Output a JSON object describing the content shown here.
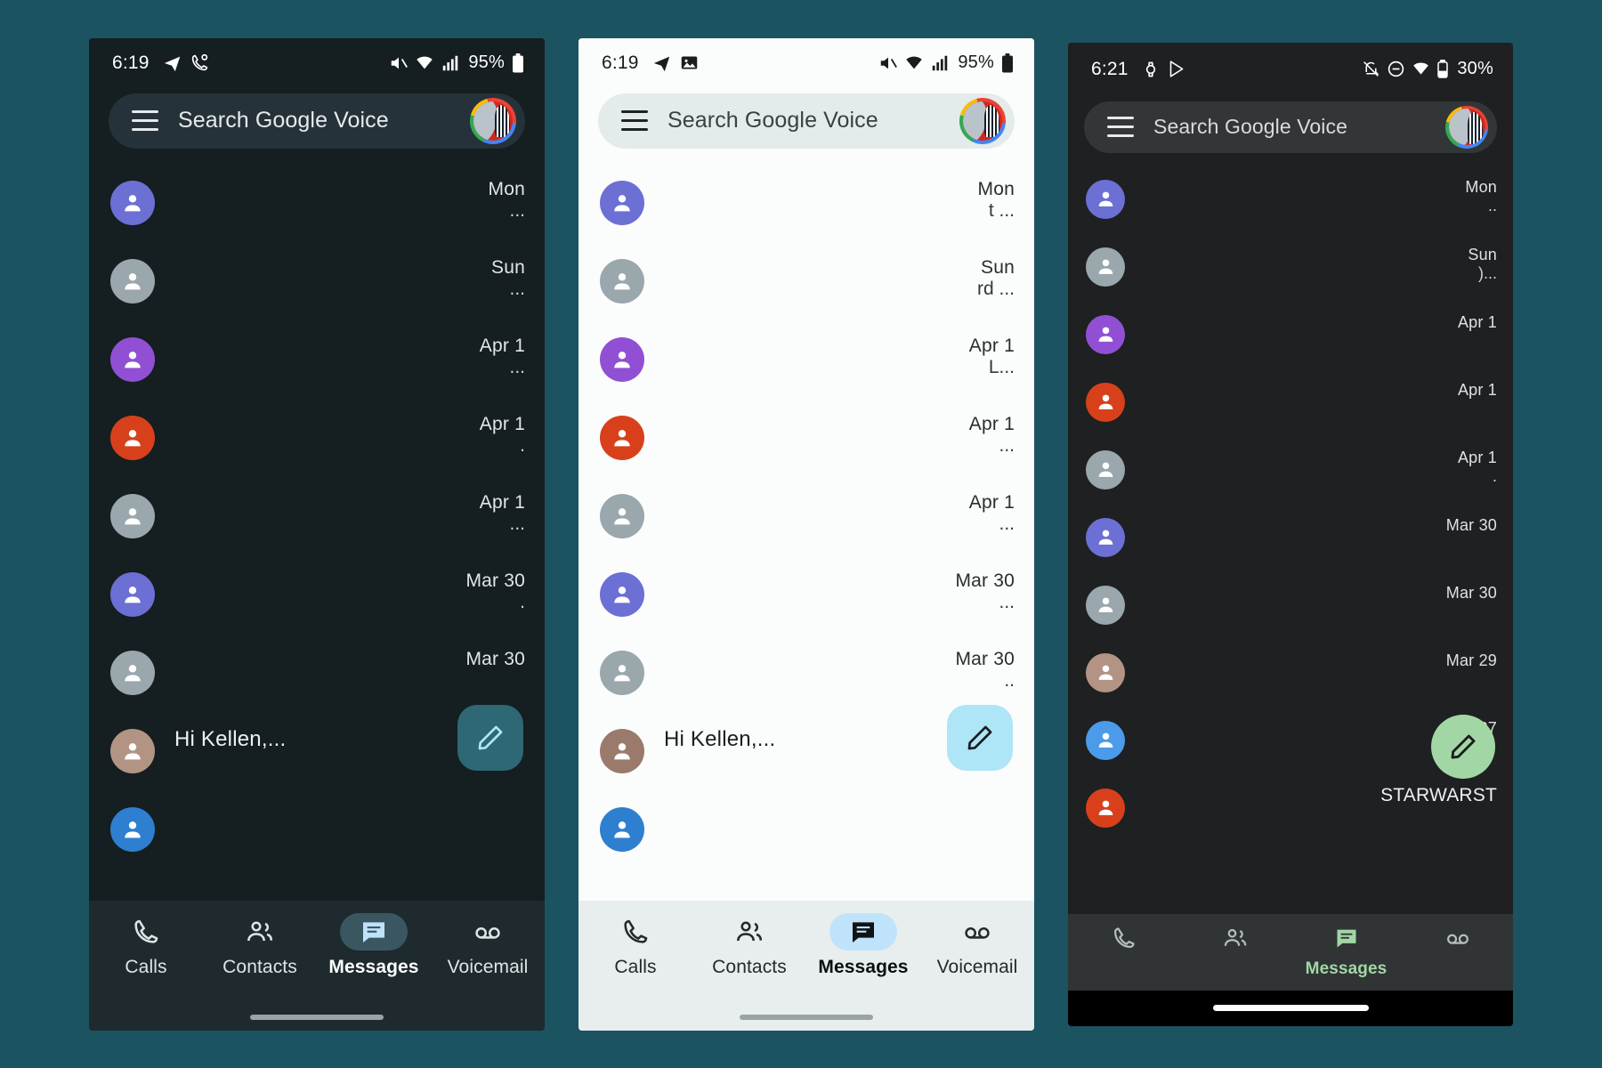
{
  "app": {
    "name": "Google Voice",
    "screen": "Messages"
  },
  "background_color": "#1b5361",
  "panels": [
    {
      "id": "panel-dark",
      "theme": "dark",
      "colors": {
        "background": "#151e20",
        "searchbar": "#263239",
        "nav": "#1e2a2e",
        "fab": "#2d6874",
        "fab_icon": "#aee5f7",
        "accent_pill": "#3a5761"
      },
      "status_bar": {
        "time": "6:19",
        "left_icons": [
          "telegram-icon",
          "call-forward-icon"
        ],
        "right_icons": [
          "volume-off-icon",
          "wifi-icon",
          "cellular-signal-icon"
        ],
        "battery_percent": "95%"
      },
      "search": {
        "placeholder": "Search Google Voice",
        "menu_icon": "hamburger-menu-icon",
        "avatar_icon": "google-account-avatar"
      },
      "conversations": [
        {
          "avatar_color": "#6c6fd4",
          "time": "Mon",
          "tail": "...",
          "redacted": true,
          "title_w": 300,
          "sub_w": 375
        },
        {
          "avatar_color": "#9aa7ad",
          "time": "Sun",
          "tail": "...",
          "redacted": true,
          "title_w": 180,
          "sub_w": 365
        },
        {
          "avatar_color": "#9150d4",
          "time": "Apr 1",
          "tail": "...",
          "redacted": true,
          "title_w": 250,
          "sub_w": 370
        },
        {
          "avatar_color": "#d8401c",
          "time": "Apr 1",
          "tail": ".",
          "redacted": true,
          "title_w": 230,
          "sub_w": 355
        },
        {
          "avatar_color": "#9aa7ad",
          "time": "Apr 1",
          "tail": "...",
          "redacted": true,
          "title_w": 210,
          "sub_w": 360
        },
        {
          "avatar_color": "#6c6fd4",
          "time": "Mar 30",
          "tail": ".",
          "redacted": true,
          "title_w": 195,
          "sub_w": 340
        },
        {
          "avatar_color": "#9aa7ad",
          "time": "Mar 30",
          "tail": "",
          "redacted": true,
          "title_w": 205,
          "sub_w": 350
        },
        {
          "avatar_color": "#b39484",
          "time": "",
          "tail": "",
          "redacted": true,
          "title_w": 175,
          "preview_text": "Hi Kellen,..."
        }
      ],
      "fab": {
        "icon": "compose-pencil-icon",
        "shape": "rounded-square"
      },
      "nav": {
        "items": [
          {
            "label": "Calls",
            "icon": "phone-icon",
            "active": false
          },
          {
            "label": "Contacts",
            "icon": "people-icon",
            "active": false
          },
          {
            "label": "Messages",
            "icon": "message-icon",
            "active": true
          },
          {
            "label": "Voicemail",
            "icon": "voicemail-icon",
            "active": false
          }
        ]
      }
    },
    {
      "id": "panel-light",
      "theme": "light",
      "colors": {
        "background": "#fbfcfc",
        "searchbar": "#e3eceb",
        "nav": "#e7eeed",
        "fab": "#aee5f7",
        "fab_icon": "#1a1c1e",
        "accent_pill": "#bfe3fb"
      },
      "status_bar": {
        "time": "6:19",
        "left_icons": [
          "telegram-icon",
          "image-icon"
        ],
        "right_icons": [
          "volume-off-icon",
          "wifi-icon",
          "cellular-signal-icon"
        ],
        "battery_percent": "95%"
      },
      "search": {
        "placeholder": "Search Google Voice",
        "menu_icon": "hamburger-menu-icon",
        "avatar_icon": "google-account-avatar"
      },
      "conversations": [
        {
          "avatar_color": "#6c6fd4",
          "time": "Mon",
          "tail": "t ...",
          "redacted": true,
          "title_w": 300,
          "sub_w": 350
        },
        {
          "avatar_color": "#9aa7ad",
          "time": "Sun",
          "tail": "rd ...",
          "redacted": true,
          "title_w": 180,
          "sub_w": 335
        },
        {
          "avatar_color": "#9150d4",
          "time": "Apr 1",
          "tail": "L...",
          "redacted": true,
          "title_w": 250,
          "sub_w": 350
        },
        {
          "avatar_color": "#d8401c",
          "time": "Apr 1",
          "tail": "...",
          "redacted": true,
          "title_w": 230,
          "sub_w": 345
        },
        {
          "avatar_color": "#9aa7ad",
          "time": "Apr 1",
          "tail": "...",
          "redacted": true,
          "title_w": 210,
          "sub_w": 345
        },
        {
          "avatar_color": "#6c6fd4",
          "time": "Mar 30",
          "tail": "...",
          "redacted": true,
          "title_w": 195,
          "sub_w": 330
        },
        {
          "avatar_color": "#9aa7ad",
          "time": "Mar 30",
          "tail": "..",
          "redacted": true,
          "title_w": 205,
          "sub_w": 335
        },
        {
          "avatar_color": "#9a7b6b",
          "time": "",
          "tail": "",
          "redacted": true,
          "title_w": 150,
          "preview_text": "Hi Kellen,..."
        }
      ],
      "fab": {
        "icon": "compose-pencil-icon",
        "shape": "rounded-square"
      },
      "nav": {
        "items": [
          {
            "label": "Calls",
            "icon": "phone-icon",
            "active": false
          },
          {
            "label": "Contacts",
            "icon": "people-icon",
            "active": false
          },
          {
            "label": "Messages",
            "icon": "message-icon",
            "active": true
          },
          {
            "label": "Voicemail",
            "icon": "voicemail-icon",
            "active": false
          }
        ]
      }
    },
    {
      "id": "panel-amoled",
      "theme": "amoled",
      "colors": {
        "background": "#1e2021",
        "searchbar": "#333637",
        "nav": "#313435",
        "fab": "#a2d7a5",
        "fab_icon": "#1a1c1e",
        "accent": "#a2d7a5"
      },
      "status_bar": {
        "time": "6:21",
        "left_icons": [
          "watch-icon",
          "play-store-icon"
        ],
        "right_icons": [
          "notifications-off-icon",
          "do-not-disturb-icon",
          "wifi-icon",
          "battery-icon"
        ],
        "battery_percent": "30%"
      },
      "search": {
        "placeholder": "Search Google Voice",
        "menu_icon": "hamburger-menu-icon",
        "avatar_icon": "google-account-avatar"
      },
      "conversations": [
        {
          "avatar_color": "#6c6fd4",
          "time": "Mon",
          "tail": "..",
          "redacted": true,
          "title_w": 175,
          "sub_w": 330
        },
        {
          "avatar_color": "#9aa7ad",
          "time": "Sun",
          "tail": ")...",
          "redacted": true,
          "title_w": 160,
          "sub_w": 320
        },
        {
          "avatar_color": "#9150d4",
          "time": "Apr 1",
          "tail": "",
          "redacted": true,
          "title_w": 200,
          "sub_w": 310
        },
        {
          "avatar_color": "#d8401c",
          "time": "Apr 1",
          "tail": "",
          "redacted": true,
          "title_w": 185,
          "sub_w": 305
        },
        {
          "avatar_color": "#9aa7ad",
          "time": "Apr 1",
          "tail": ".",
          "redacted": true,
          "title_w": 170,
          "sub_w": 300
        },
        {
          "avatar_color": "#6c6fd4",
          "time": "Mar 30",
          "tail": "",
          "redacted": true,
          "title_w": 165,
          "sub_w": 290
        },
        {
          "avatar_color": "#9aa7ad",
          "time": "Mar 30",
          "tail": "",
          "redacted": true,
          "title_w": 175,
          "sub_w": 285
        },
        {
          "avatar_color": "#b39484",
          "time": "Mar 29",
          "tail": "",
          "redacted": true,
          "title_w": 155,
          "sub_w": 275
        },
        {
          "avatar_color": "#4c9bea",
          "time": "Mar 27",
          "tail": "",
          "redacted": true,
          "title_w": 165,
          "sub_w": 280
        },
        {
          "avatar_color": "#d8401c",
          "time": "",
          "tail": "",
          "redacted": true,
          "title_w": 160,
          "preview_text": "STARWARST"
        }
      ],
      "fab": {
        "icon": "compose-pencil-icon",
        "shape": "circle"
      },
      "nav": {
        "items": [
          {
            "label": "",
            "icon": "phone-icon",
            "active": false
          },
          {
            "label": "",
            "icon": "people-icon",
            "active": false
          },
          {
            "label": "Messages",
            "icon": "message-icon",
            "active": true
          },
          {
            "label": "",
            "icon": "voicemail-icon",
            "active": false
          }
        ]
      }
    }
  ]
}
